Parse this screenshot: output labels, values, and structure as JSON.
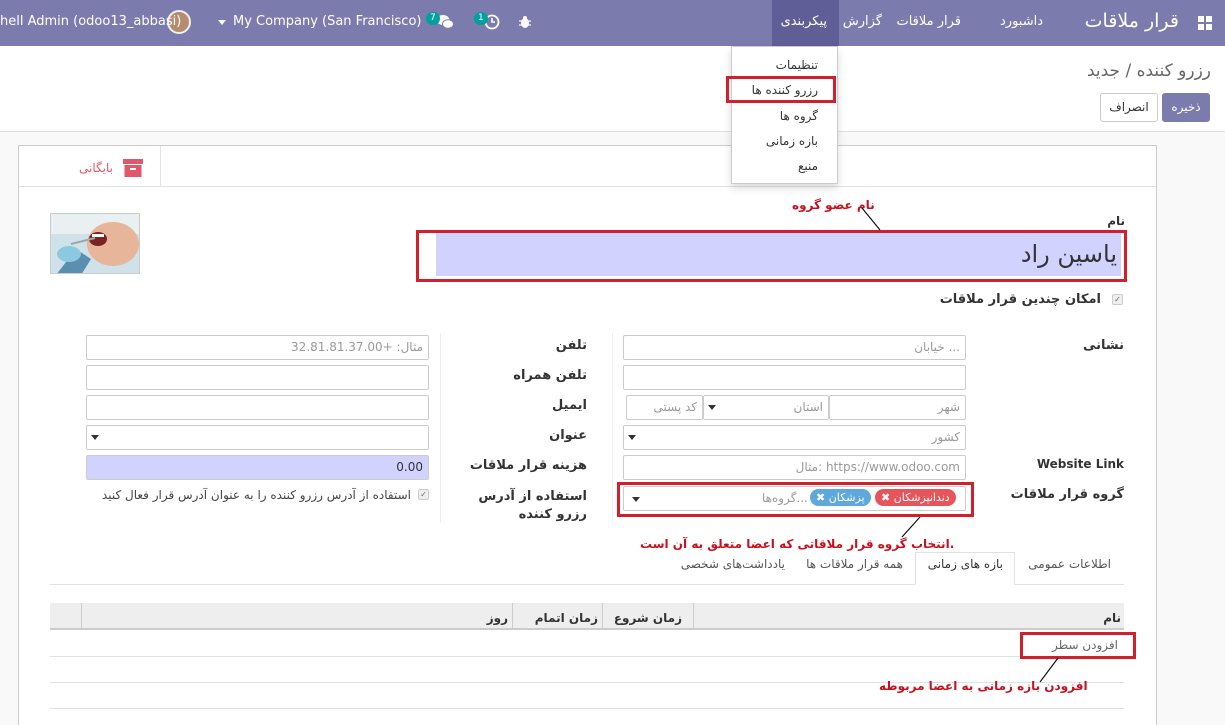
{
  "navbar": {
    "app_title": "قرار ملاقات",
    "menu": [
      "داشبورد",
      "قرار ملاقات",
      "گزارش",
      "پیکربندی"
    ],
    "company": "My Company (San Francisco)",
    "user": "hell Admin (odoo13_abbasi)",
    "messages_count": "7",
    "activities_count": "1"
  },
  "config_menu": [
    "تنظیمات",
    "رزرو کننده ها",
    "گروه ها",
    "بازه زمانی",
    "منبع"
  ],
  "breadcrumb": "رزرو کننده / جدید",
  "buttons": {
    "save": "ذخیره",
    "discard": "انصراف",
    "archive": "بایگانی"
  },
  "form": {
    "name_label": "نام",
    "name_value": "یاسین راد",
    "name_annotation": "نام عضو گروه",
    "multi_booking_label": "امکان چندین قرار ملاقات",
    "address_label": "نشانی",
    "street_placeholder": "خیابان ...",
    "city_placeholder": "شهر",
    "state_placeholder": "استان",
    "zip_placeholder": "کد پستی",
    "country_placeholder": "کشور",
    "website_label": "Website Link",
    "website_placeholder": "مثال: https://www.odoo.com",
    "group_label": "گروه قرار ملاقات",
    "group_tags": [
      "دندانپزشکان",
      "پزشکان"
    ],
    "group_placeholder": "گروه‌ها...",
    "group_annotation": "انتخاب گروه قرار ملاقاتی که اعضا متعلق به آن است.",
    "phone_label": "تلفن",
    "phone_placeholder": "مثال: +32.81.81.37.00",
    "mobile_label": "تلفن همراه",
    "email_label": "ایمیل",
    "title_label": "عنوان",
    "fee_label": "هزینه قرار ملاقات",
    "fee_value": "0.00",
    "use_address_label": "استفاده از آدرس رزرو کننده",
    "use_address_text": "استفاده از آدرس رزرو کننده را به عنوان آدرس قرار فعال کنید"
  },
  "tabs": [
    "اطلاعات عمومی",
    "بازه های زمانی",
    "همه قرار ملاقات ها",
    "یادداشت‌های شخصی"
  ],
  "table": {
    "columns": [
      "نام",
      "زمان شروع",
      "زمان اتمام",
      "روز"
    ],
    "add_line": "افزودن سطر",
    "add_annotation": "افزودن بازه زمانی به اعضا مربوطه"
  },
  "colors": {
    "brand": "#7c7bad",
    "annotation": "#d0202e",
    "tag_red": "#e8545c",
    "tag_blue": "#5fa8dc"
  }
}
